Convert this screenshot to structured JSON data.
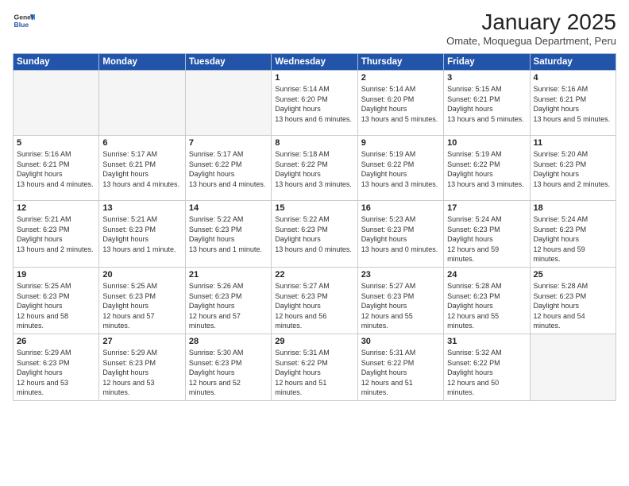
{
  "header": {
    "logo_general": "General",
    "logo_blue": "Blue",
    "month_title": "January 2025",
    "location": "Omate, Moquegua Department, Peru"
  },
  "weekdays": [
    "Sunday",
    "Monday",
    "Tuesday",
    "Wednesday",
    "Thursday",
    "Friday",
    "Saturday"
  ],
  "weeks": [
    [
      {
        "day": "",
        "empty": true
      },
      {
        "day": "",
        "empty": true
      },
      {
        "day": "",
        "empty": true
      },
      {
        "day": "1",
        "sunrise": "5:14 AM",
        "sunset": "6:20 PM",
        "daylight": "13 hours and 6 minutes."
      },
      {
        "day": "2",
        "sunrise": "5:14 AM",
        "sunset": "6:20 PM",
        "daylight": "13 hours and 5 minutes."
      },
      {
        "day": "3",
        "sunrise": "5:15 AM",
        "sunset": "6:21 PM",
        "daylight": "13 hours and 5 minutes."
      },
      {
        "day": "4",
        "sunrise": "5:16 AM",
        "sunset": "6:21 PM",
        "daylight": "13 hours and 5 minutes."
      }
    ],
    [
      {
        "day": "5",
        "sunrise": "5:16 AM",
        "sunset": "6:21 PM",
        "daylight": "13 hours and 4 minutes."
      },
      {
        "day": "6",
        "sunrise": "5:17 AM",
        "sunset": "6:21 PM",
        "daylight": "13 hours and 4 minutes."
      },
      {
        "day": "7",
        "sunrise": "5:17 AM",
        "sunset": "6:22 PM",
        "daylight": "13 hours and 4 minutes."
      },
      {
        "day": "8",
        "sunrise": "5:18 AM",
        "sunset": "6:22 PM",
        "daylight": "13 hours and 3 minutes."
      },
      {
        "day": "9",
        "sunrise": "5:19 AM",
        "sunset": "6:22 PM",
        "daylight": "13 hours and 3 minutes."
      },
      {
        "day": "10",
        "sunrise": "5:19 AM",
        "sunset": "6:22 PM",
        "daylight": "13 hours and 3 minutes."
      },
      {
        "day": "11",
        "sunrise": "5:20 AM",
        "sunset": "6:23 PM",
        "daylight": "13 hours and 2 minutes."
      }
    ],
    [
      {
        "day": "12",
        "sunrise": "5:21 AM",
        "sunset": "6:23 PM",
        "daylight": "13 hours and 2 minutes."
      },
      {
        "day": "13",
        "sunrise": "5:21 AM",
        "sunset": "6:23 PM",
        "daylight": "13 hours and 1 minute."
      },
      {
        "day": "14",
        "sunrise": "5:22 AM",
        "sunset": "6:23 PM",
        "daylight": "13 hours and 1 minute."
      },
      {
        "day": "15",
        "sunrise": "5:22 AM",
        "sunset": "6:23 PM",
        "daylight": "13 hours and 0 minutes."
      },
      {
        "day": "16",
        "sunrise": "5:23 AM",
        "sunset": "6:23 PM",
        "daylight": "13 hours and 0 minutes."
      },
      {
        "day": "17",
        "sunrise": "5:24 AM",
        "sunset": "6:23 PM",
        "daylight": "12 hours and 59 minutes."
      },
      {
        "day": "18",
        "sunrise": "5:24 AM",
        "sunset": "6:23 PM",
        "daylight": "12 hours and 59 minutes."
      }
    ],
    [
      {
        "day": "19",
        "sunrise": "5:25 AM",
        "sunset": "6:23 PM",
        "daylight": "12 hours and 58 minutes."
      },
      {
        "day": "20",
        "sunrise": "5:25 AM",
        "sunset": "6:23 PM",
        "daylight": "12 hours and 57 minutes."
      },
      {
        "day": "21",
        "sunrise": "5:26 AM",
        "sunset": "6:23 PM",
        "daylight": "12 hours and 57 minutes."
      },
      {
        "day": "22",
        "sunrise": "5:27 AM",
        "sunset": "6:23 PM",
        "daylight": "12 hours and 56 minutes."
      },
      {
        "day": "23",
        "sunrise": "5:27 AM",
        "sunset": "6:23 PM",
        "daylight": "12 hours and 55 minutes."
      },
      {
        "day": "24",
        "sunrise": "5:28 AM",
        "sunset": "6:23 PM",
        "daylight": "12 hours and 55 minutes."
      },
      {
        "day": "25",
        "sunrise": "5:28 AM",
        "sunset": "6:23 PM",
        "daylight": "12 hours and 54 minutes."
      }
    ],
    [
      {
        "day": "26",
        "sunrise": "5:29 AM",
        "sunset": "6:23 PM",
        "daylight": "12 hours and 53 minutes."
      },
      {
        "day": "27",
        "sunrise": "5:29 AM",
        "sunset": "6:23 PM",
        "daylight": "12 hours and 53 minutes."
      },
      {
        "day": "28",
        "sunrise": "5:30 AM",
        "sunset": "6:23 PM",
        "daylight": "12 hours and 52 minutes."
      },
      {
        "day": "29",
        "sunrise": "5:31 AM",
        "sunset": "6:22 PM",
        "daylight": "12 hours and 51 minutes."
      },
      {
        "day": "30",
        "sunrise": "5:31 AM",
        "sunset": "6:22 PM",
        "daylight": "12 hours and 51 minutes."
      },
      {
        "day": "31",
        "sunrise": "5:32 AM",
        "sunset": "6:22 PM",
        "daylight": "12 hours and 50 minutes."
      },
      {
        "day": "",
        "empty": true
      }
    ]
  ],
  "labels": {
    "sunrise": "Sunrise:",
    "sunset": "Sunset:",
    "daylight": "Daylight hours"
  }
}
